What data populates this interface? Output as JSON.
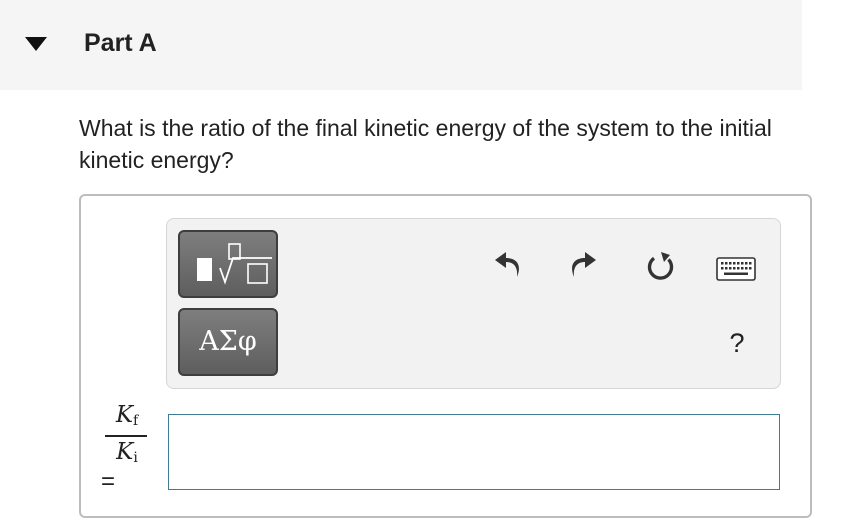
{
  "part": {
    "title": "Part A",
    "collapse_icon": "caret-down-icon"
  },
  "question": {
    "text": "What is the ratio of the final kinetic energy of the system to the initial kinetic energy?"
  },
  "toolbar": {
    "templates_button": "templates-icon",
    "symbols_label": "ΑΣφ",
    "undo_icon": "undo-icon",
    "redo_icon": "redo-icon",
    "reset_icon": "reset-icon",
    "keyboard_icon": "keyboard-icon",
    "help_label": "?"
  },
  "answer": {
    "lhs_numerator_var": "K",
    "lhs_numerator_sub": "f",
    "lhs_denominator_var": "K",
    "lhs_denominator_sub": "i",
    "equals": "=",
    "value": ""
  },
  "colors": {
    "header_bg": "#f5f5f5",
    "button_bg": "#6e6e6e",
    "input_border": "#3e7d94"
  }
}
